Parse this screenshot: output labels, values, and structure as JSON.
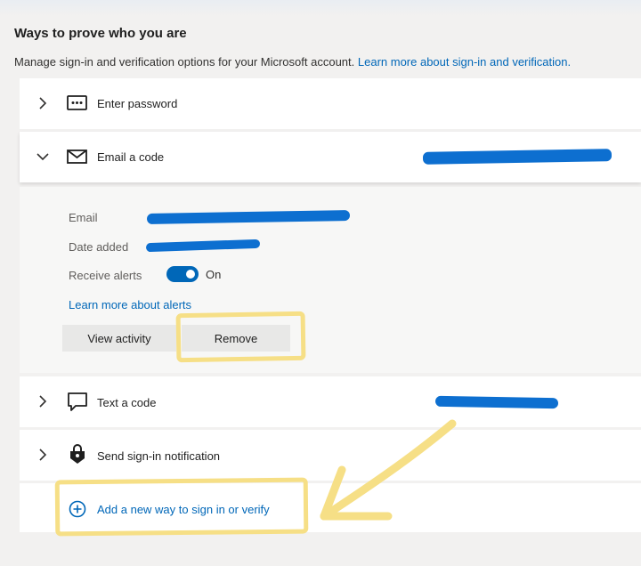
{
  "section": {
    "title": "Ways to prove who you are",
    "description": "Manage sign-in and verification options for your Microsoft account.",
    "learn_more_link": "Learn more about sign-in and verification."
  },
  "methods": {
    "password": {
      "label": "Enter password",
      "icon": "password-dots-icon",
      "expanded": false
    },
    "email": {
      "label": "Email a code",
      "icon": "mail-icon",
      "expanded": true
    },
    "text": {
      "label": "Text a code",
      "icon": "chat-bubble-icon",
      "expanded": false
    },
    "notification": {
      "label": "Send sign-in notification",
      "icon": "authenticator-lock-icon",
      "expanded": false
    }
  },
  "email_details": {
    "email_label": "Email",
    "date_added_label": "Date added",
    "receive_alerts_label": "Receive alerts",
    "receive_alerts_state": "On",
    "learn_alerts_link": "Learn more about alerts",
    "view_activity_button": "View activity",
    "remove_button": "Remove"
  },
  "add_method": {
    "label": "Add a new way to sign in or verify",
    "icon": "plus-circle-icon"
  },
  "colors": {
    "accent": "#0067b8",
    "redaction": "#0d6fd0",
    "annotation": "#f6df86",
    "background": "#f2f1f0"
  }
}
